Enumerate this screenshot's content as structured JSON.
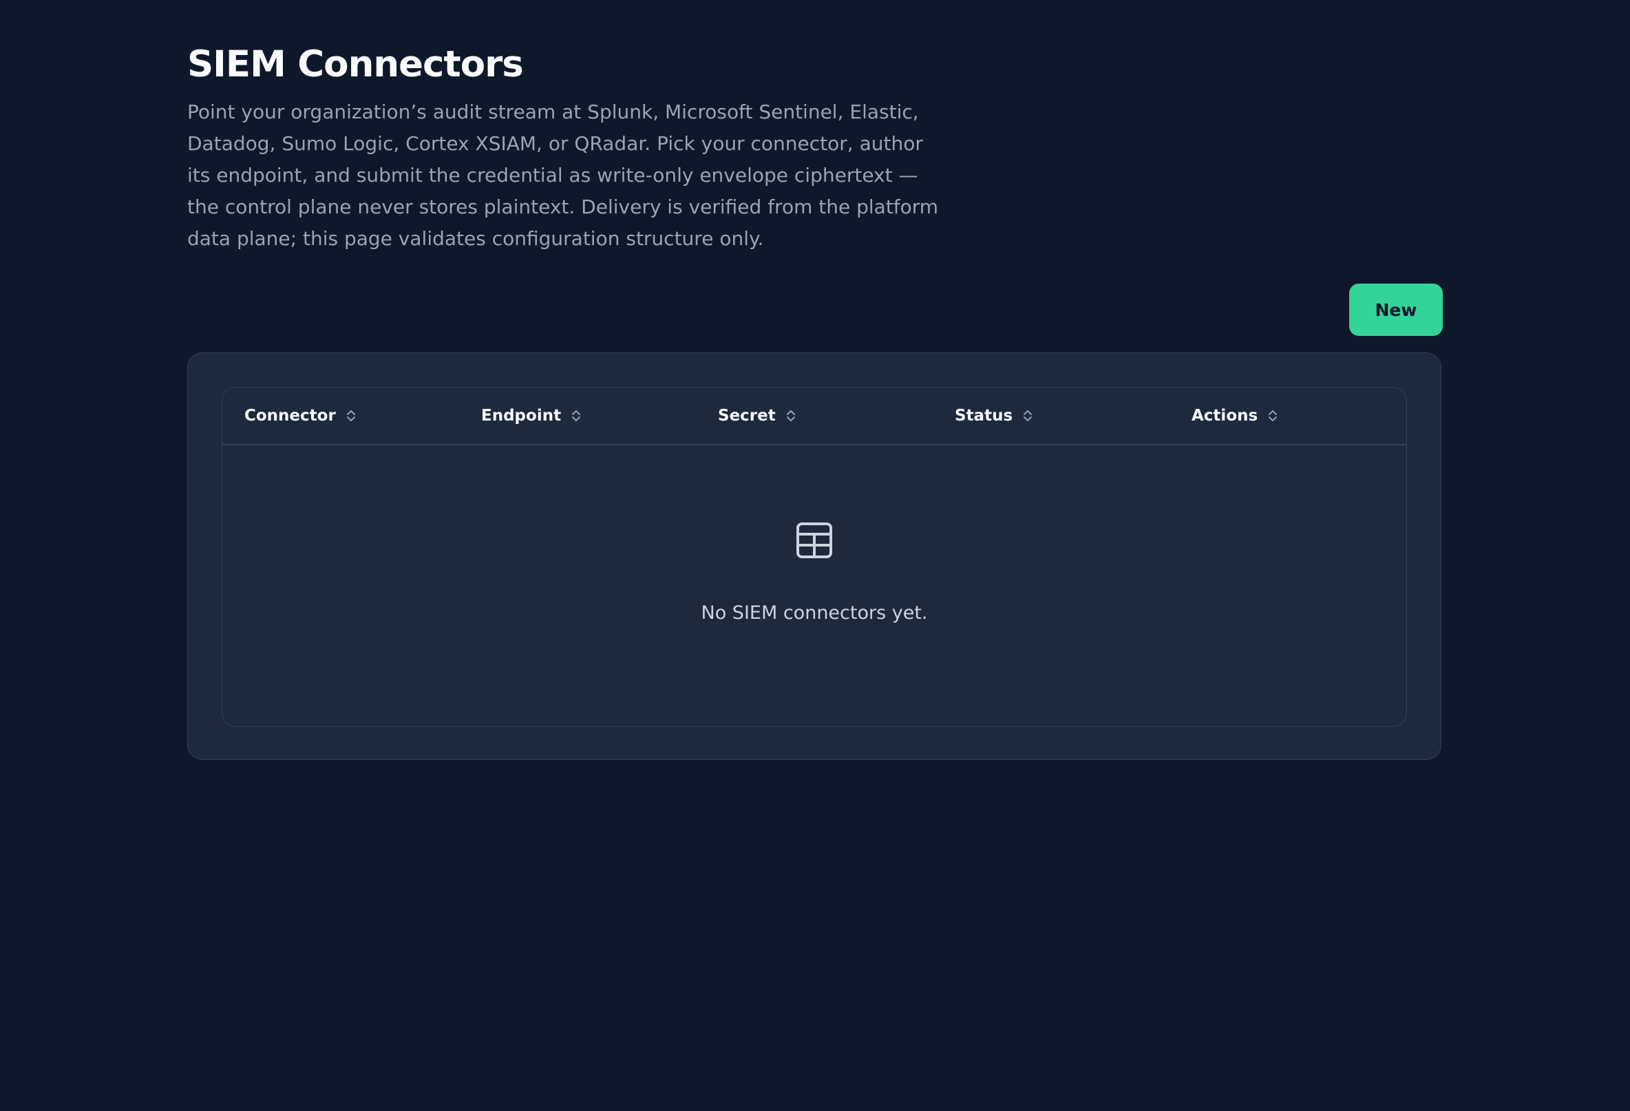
{
  "page": {
    "title": "SIEM Connectors",
    "description": "Point your organization’s audit stream at Splunk, Microsoft Sentinel, Elastic, Datadog, Sumo Logic, Cortex XSIAM, or QRadar. Pick your connector, author its endpoint, and submit the credential as write-only envelope ciphertext — the control plane never stores plaintext. Delivery is verified from the platform data plane; this page validates configuration structure only."
  },
  "toolbar": {
    "new_label": "New"
  },
  "table": {
    "columns": [
      {
        "label": "Connector",
        "icon": "sort-icon"
      },
      {
        "label": "Endpoint",
        "icon": "sort-icon"
      },
      {
        "label": "Secret",
        "icon": "sort-icon"
      },
      {
        "label": "Status",
        "icon": "sort-icon"
      },
      {
        "label": "Actions",
        "icon": "sort-icon"
      }
    ],
    "empty": {
      "icon": "table-icon",
      "message": "No SIEM connectors yet."
    }
  },
  "colors": {
    "background": "#0f172a",
    "surface": "#1e293b",
    "border": "#334155",
    "accent": "#34d399"
  }
}
